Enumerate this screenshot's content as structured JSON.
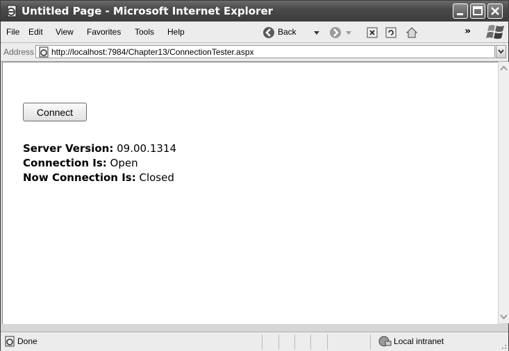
{
  "window": {
    "title": "Untitled Page - Microsoft Internet Explorer"
  },
  "menu": {
    "items": [
      "File",
      "Edit",
      "View",
      "Favorites",
      "Tools",
      "Help"
    ]
  },
  "toolbar": {
    "back_label": "Back",
    "overflow": "»"
  },
  "address": {
    "label": "Address",
    "url": "http://localhost:7984/Chapter13/ConnectionTester.aspx"
  },
  "page": {
    "connect_label": "Connect",
    "lines": [
      {
        "label": "Server Version:",
        "value": " 09.00.1314"
      },
      {
        "label": "Connection Is:",
        "value": " Open"
      },
      {
        "label": "Now Connection Is:",
        "value": " Closed"
      }
    ]
  },
  "status": {
    "text": "Done",
    "zone": "Local intranet"
  }
}
